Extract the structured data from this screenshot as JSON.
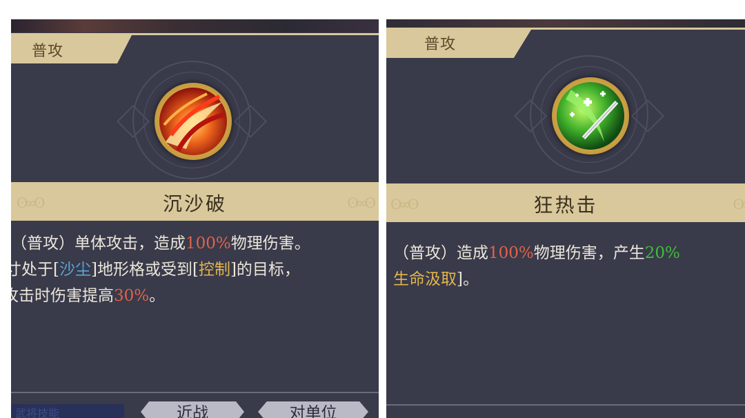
{
  "left_panel": {
    "tab_label": "普攻",
    "skill_name": "沉沙破",
    "desc_line1": {
      "prefix": "（普攻）单体攻击，造成",
      "pct": "100%",
      "suffix": "物理伤害。"
    },
    "desc_line2": {
      "a": "寸处于[",
      "sand": "沙尘",
      "b": "]地形格或受到[",
      "control": "控制",
      "c": "]的目标，"
    },
    "desc_line3": {
      "prefix": "攻击时伤害提高",
      "pct": "30%",
      "suffix": "。"
    },
    "tags": [
      "近战",
      "对单位"
    ],
    "bottom_left_text": "武将技能"
  },
  "right_panel": {
    "tab_label": "普攻",
    "skill_name": "狂热击",
    "desc_line1": {
      "prefix": "（普攻）造成",
      "pct": "100%",
      "mid": "物理伤害，产生",
      "green": "20%"
    },
    "desc_line2": {
      "gold": "生命汲取",
      "suffix": "]。"
    }
  },
  "colors": {
    "panel_bg": "#393a4a",
    "accent_band": "#d9c89b",
    "highlight_red": "#e0634a",
    "highlight_blue": "#5aa7d6",
    "highlight_gold": "#e3b64a",
    "highlight_green": "#3fbe3a"
  },
  "icons": {
    "left_skill": "fire-slash-icon",
    "right_skill": "green-heal-strike-icon"
  }
}
